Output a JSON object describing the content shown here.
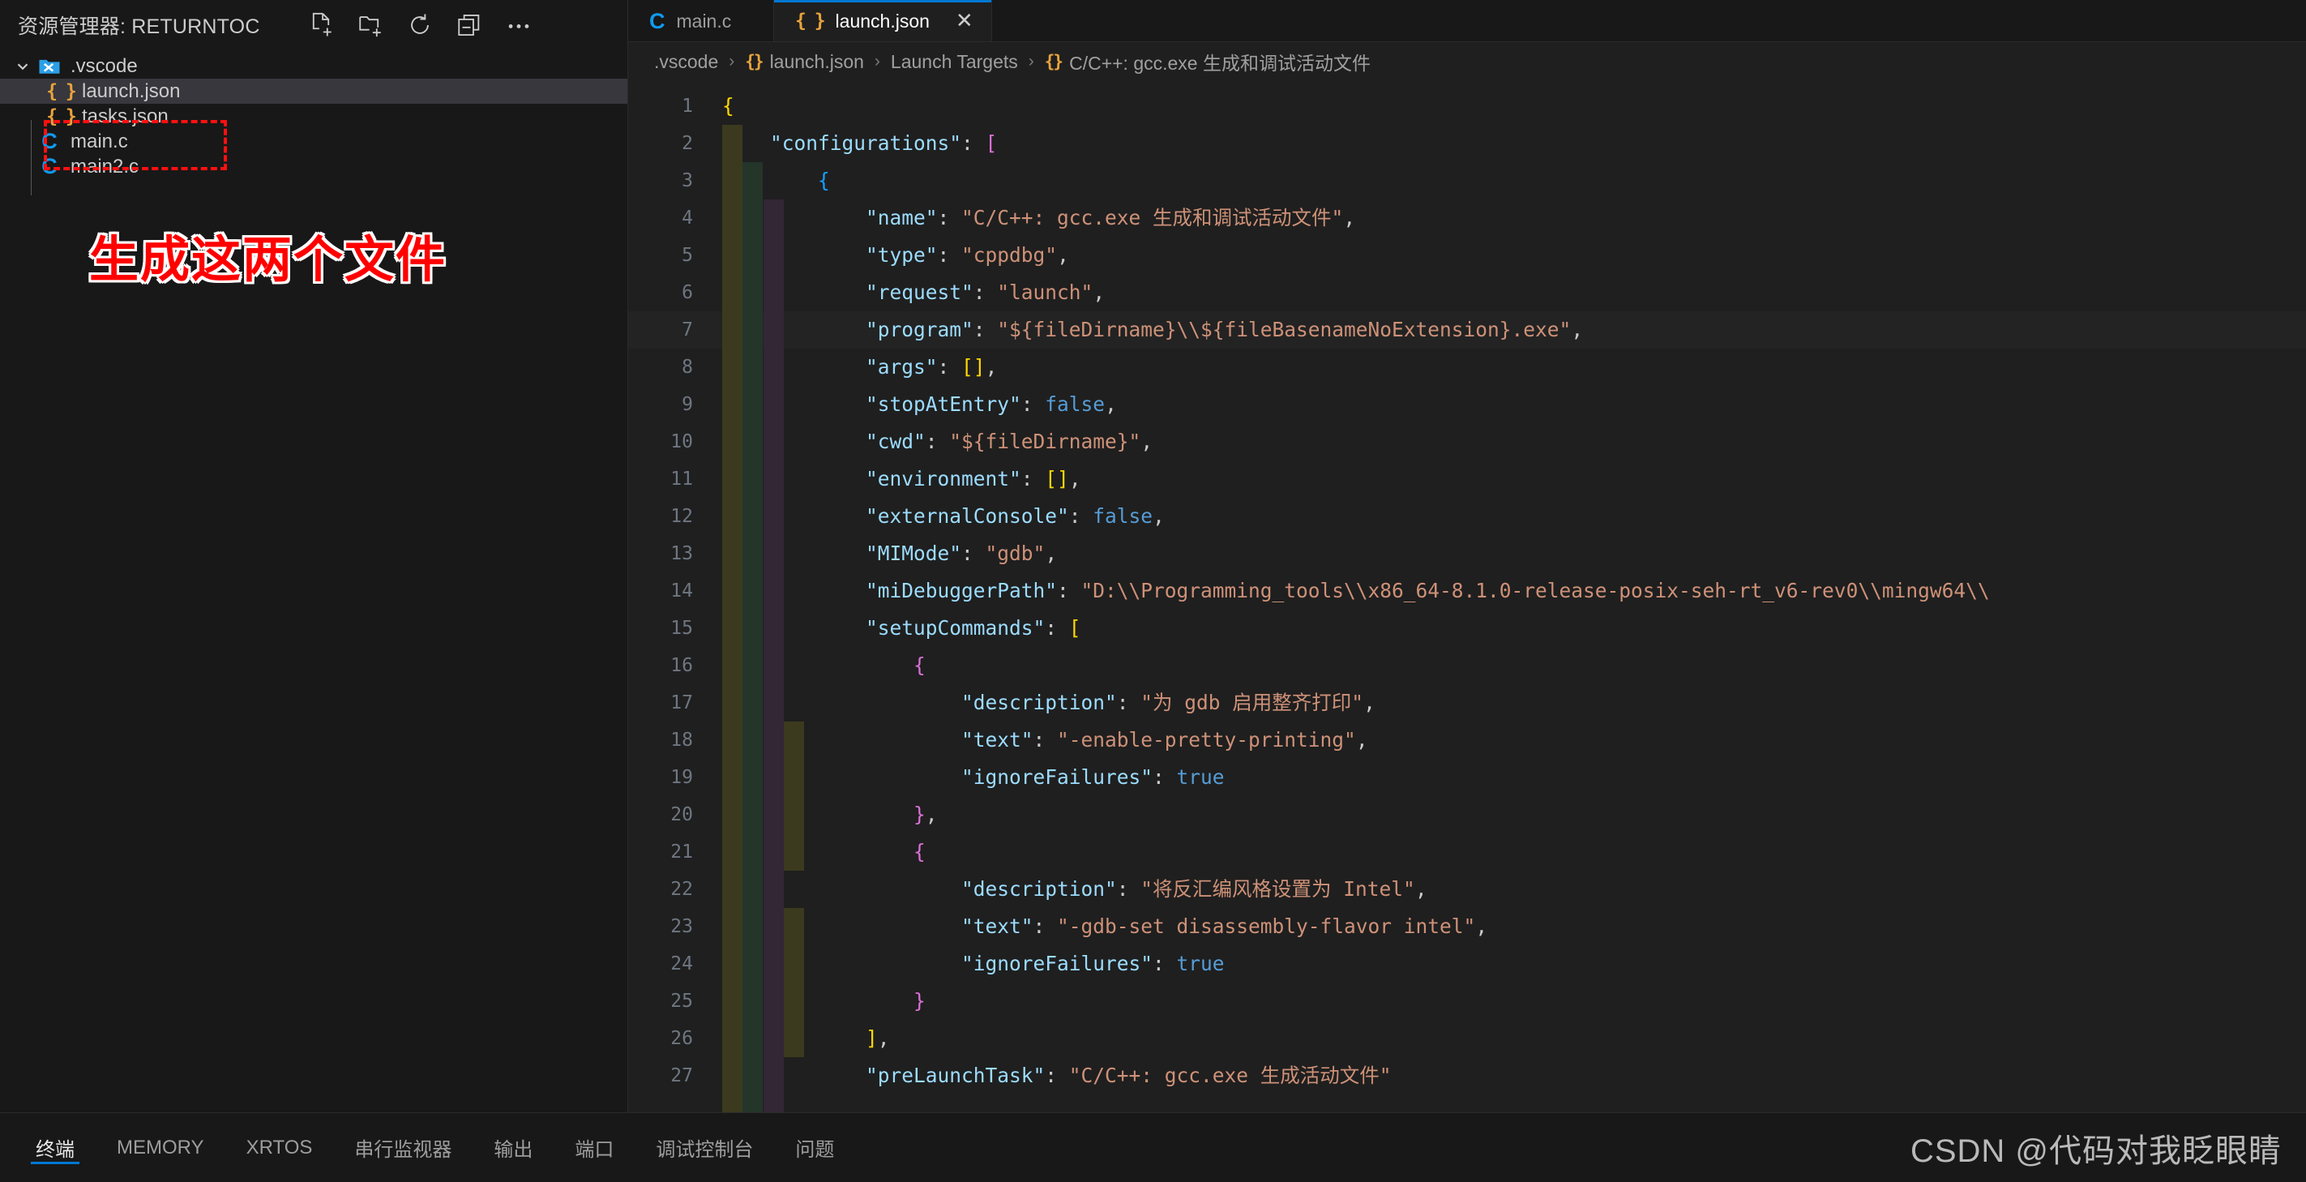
{
  "sidebar": {
    "title": "资源管理器: RETURNTOC",
    "actions": [
      {
        "name": "new-file-icon",
        "label": "新建文件"
      },
      {
        "name": "new-folder-icon",
        "label": "新建文件夹"
      },
      {
        "name": "refresh-icon",
        "label": "刷新资源管理器"
      },
      {
        "name": "collapse-all-icon",
        "label": "在资源管理器中折叠文件夹"
      },
      {
        "name": "more-actions-icon",
        "label": "视图和更多操作..."
      }
    ],
    "tree": [
      {
        "label": ".vscode",
        "type": "folder",
        "depth": 1,
        "expanded": true,
        "selected": false
      },
      {
        "label": "launch.json",
        "type": "json",
        "depth": 2,
        "expanded": false,
        "selected": true
      },
      {
        "label": "tasks.json",
        "type": "json",
        "depth": 2,
        "expanded": false,
        "selected": false
      },
      {
        "label": "main.c",
        "type": "c",
        "depth": 1,
        "expanded": false,
        "selected": false
      },
      {
        "label": "main2.c",
        "type": "c",
        "depth": 1,
        "expanded": false,
        "selected": false
      }
    ],
    "annotation_text": "生成这两个文件",
    "annotation_color": "#ff0000"
  },
  "tabs": [
    {
      "label": "main.c",
      "icon": "c-file-icon",
      "active": false,
      "closable": false
    },
    {
      "label": "launch.json",
      "icon": "json-file-icon",
      "active": true,
      "closable": true,
      "close_glyph": "✕"
    }
  ],
  "breadcrumb": {
    "separator": "›",
    "items": [
      {
        "label": ".vscode",
        "icon": ""
      },
      {
        "label": "launch.json",
        "icon": "{}"
      },
      {
        "label": "Launch Targets",
        "icon": ""
      },
      {
        "label": "C/C++: gcc.exe 生成和调试活动文件",
        "icon": "{}"
      }
    ]
  },
  "editor": {
    "active_line": 7,
    "lines": [
      {
        "n": 1,
        "indent": 0,
        "tokens": [
          {
            "t": "{",
            "c": "br-y"
          }
        ]
      },
      {
        "n": 2,
        "indent": 1,
        "tokens": [
          {
            "t": "\"configurations\"",
            "c": "k"
          },
          {
            "t": ": ",
            "c": "p"
          },
          {
            "t": "[",
            "c": "br-m"
          }
        ]
      },
      {
        "n": 3,
        "indent": 2,
        "tokens": [
          {
            "t": "{",
            "c": "br-b"
          }
        ]
      },
      {
        "n": 4,
        "indent": 3,
        "tokens": [
          {
            "t": "\"name\"",
            "c": "k"
          },
          {
            "t": ": ",
            "c": "p"
          },
          {
            "t": "\"C/C++: gcc.exe 生成和调试活动文件\"",
            "c": "s"
          },
          {
            "t": ",",
            "c": "p"
          }
        ]
      },
      {
        "n": 5,
        "indent": 3,
        "tokens": [
          {
            "t": "\"type\"",
            "c": "k"
          },
          {
            "t": ": ",
            "c": "p"
          },
          {
            "t": "\"cppdbg\"",
            "c": "s"
          },
          {
            "t": ",",
            "c": "p"
          }
        ]
      },
      {
        "n": 6,
        "indent": 3,
        "tokens": [
          {
            "t": "\"request\"",
            "c": "k"
          },
          {
            "t": ": ",
            "c": "p"
          },
          {
            "t": "\"launch\"",
            "c": "s"
          },
          {
            "t": ",",
            "c": "p"
          }
        ]
      },
      {
        "n": 7,
        "indent": 3,
        "tokens": [
          {
            "t": "\"program\"",
            "c": "k"
          },
          {
            "t": ": ",
            "c": "p"
          },
          {
            "t": "\"${fileDirname}\\\\${fileBasenameNoExtension}.exe\"",
            "c": "s"
          },
          {
            "t": ",",
            "c": "p"
          }
        ]
      },
      {
        "n": 8,
        "indent": 3,
        "tokens": [
          {
            "t": "\"args\"",
            "c": "k"
          },
          {
            "t": ": ",
            "c": "p"
          },
          {
            "t": "[]",
            "c": "br-y"
          },
          {
            "t": ",",
            "c": "p"
          }
        ]
      },
      {
        "n": 9,
        "indent": 3,
        "tokens": [
          {
            "t": "\"stopAtEntry\"",
            "c": "k"
          },
          {
            "t": ": ",
            "c": "p"
          },
          {
            "t": "false",
            "c": "b"
          },
          {
            "t": ",",
            "c": "p"
          }
        ]
      },
      {
        "n": 10,
        "indent": 3,
        "tokens": [
          {
            "t": "\"cwd\"",
            "c": "k"
          },
          {
            "t": ": ",
            "c": "p"
          },
          {
            "t": "\"${fileDirname}\"",
            "c": "s"
          },
          {
            "t": ",",
            "c": "p"
          }
        ]
      },
      {
        "n": 11,
        "indent": 3,
        "tokens": [
          {
            "t": "\"environment\"",
            "c": "k"
          },
          {
            "t": ": ",
            "c": "p"
          },
          {
            "t": "[]",
            "c": "br-y"
          },
          {
            "t": ",",
            "c": "p"
          }
        ]
      },
      {
        "n": 12,
        "indent": 3,
        "tokens": [
          {
            "t": "\"externalConsole\"",
            "c": "k"
          },
          {
            "t": ": ",
            "c": "p"
          },
          {
            "t": "false",
            "c": "b"
          },
          {
            "t": ",",
            "c": "p"
          }
        ]
      },
      {
        "n": 13,
        "indent": 3,
        "tokens": [
          {
            "t": "\"MIMode\"",
            "c": "k"
          },
          {
            "t": ": ",
            "c": "p"
          },
          {
            "t": "\"gdb\"",
            "c": "s"
          },
          {
            "t": ",",
            "c": "p"
          }
        ]
      },
      {
        "n": 14,
        "indent": 3,
        "tokens": [
          {
            "t": "\"miDebuggerPath\"",
            "c": "k"
          },
          {
            "t": ": ",
            "c": "p"
          },
          {
            "t": "\"D:\\\\Programming_tools\\\\x86_64-8.1.0-release-posix-seh-rt_v6-rev0\\\\mingw64\\\\",
            "c": "s"
          }
        ]
      },
      {
        "n": 15,
        "indent": 3,
        "tokens": [
          {
            "t": "\"setupCommands\"",
            "c": "k"
          },
          {
            "t": ": ",
            "c": "p"
          },
          {
            "t": "[",
            "c": "br-y"
          }
        ]
      },
      {
        "n": 16,
        "indent": 4,
        "tokens": [
          {
            "t": "{",
            "c": "br-m"
          }
        ]
      },
      {
        "n": 17,
        "indent": 5,
        "tokens": [
          {
            "t": "\"description\"",
            "c": "k"
          },
          {
            "t": ": ",
            "c": "p"
          },
          {
            "t": "\"为 gdb 启用整齐打印\"",
            "c": "s"
          },
          {
            "t": ",",
            "c": "p"
          }
        ]
      },
      {
        "n": 18,
        "indent": 5,
        "tokens": [
          {
            "t": "\"text\"",
            "c": "k"
          },
          {
            "t": ": ",
            "c": "p"
          },
          {
            "t": "\"-enable-pretty-printing\"",
            "c": "s"
          },
          {
            "t": ",",
            "c": "p"
          }
        ]
      },
      {
        "n": 19,
        "indent": 5,
        "tokens": [
          {
            "t": "\"ignoreFailures\"",
            "c": "k"
          },
          {
            "t": ": ",
            "c": "p"
          },
          {
            "t": "true",
            "c": "b"
          }
        ]
      },
      {
        "n": 20,
        "indent": 4,
        "tokens": [
          {
            "t": "}",
            "c": "br-m"
          },
          {
            "t": ",",
            "c": "p"
          }
        ]
      },
      {
        "n": 21,
        "indent": 4,
        "tokens": [
          {
            "t": "{",
            "c": "br-m"
          }
        ]
      },
      {
        "n": 22,
        "indent": 5,
        "tokens": [
          {
            "t": "\"description\"",
            "c": "k"
          },
          {
            "t": ": ",
            "c": "p"
          },
          {
            "t": "\"将反汇编风格设置为 Intel\"",
            "c": "s"
          },
          {
            "t": ",",
            "c": "p"
          }
        ]
      },
      {
        "n": 23,
        "indent": 5,
        "tokens": [
          {
            "t": "\"text\"",
            "c": "k"
          },
          {
            "t": ": ",
            "c": "p"
          },
          {
            "t": "\"-gdb-set disassembly-flavor intel\"",
            "c": "s"
          },
          {
            "t": ",",
            "c": "p"
          }
        ]
      },
      {
        "n": 24,
        "indent": 5,
        "tokens": [
          {
            "t": "\"ignoreFailures\"",
            "c": "k"
          },
          {
            "t": ": ",
            "c": "p"
          },
          {
            "t": "true",
            "c": "b"
          }
        ]
      },
      {
        "n": 25,
        "indent": 4,
        "tokens": [
          {
            "t": "}",
            "c": "br-m"
          }
        ]
      },
      {
        "n": 26,
        "indent": 3,
        "tokens": [
          {
            "t": "]",
            "c": "br-y"
          },
          {
            "t": ",",
            "c": "p"
          }
        ]
      },
      {
        "n": 27,
        "indent": 3,
        "tokens": [
          {
            "t": "\"preLaunchTask\"",
            "c": "k"
          },
          {
            "t": ": ",
            "c": "p"
          },
          {
            "t": "\"C/C++: gcc.exe 生成活动文件\"",
            "c": "s"
          }
        ]
      }
    ]
  },
  "panel": {
    "tabs": [
      {
        "label": "终端",
        "active": true
      },
      {
        "label": "MEMORY",
        "active": false
      },
      {
        "label": "XRTOS",
        "active": false
      },
      {
        "label": "串行监视器",
        "active": false
      },
      {
        "label": "输出",
        "active": false
      },
      {
        "label": "端口",
        "active": false
      },
      {
        "label": "调试控制台",
        "active": false
      },
      {
        "label": "问题",
        "active": false
      }
    ],
    "watermark": "CSDN @代码对我眨眼睛"
  },
  "colors": {
    "accent": "#0078d4",
    "json_icon": "#e8a33d",
    "c_icon": "#0f9bf0",
    "annotation": "#ff0000",
    "selected_row": "#37373d",
    "sidebar_bg": "#181818",
    "editor_bg": "#1f1f1f"
  }
}
